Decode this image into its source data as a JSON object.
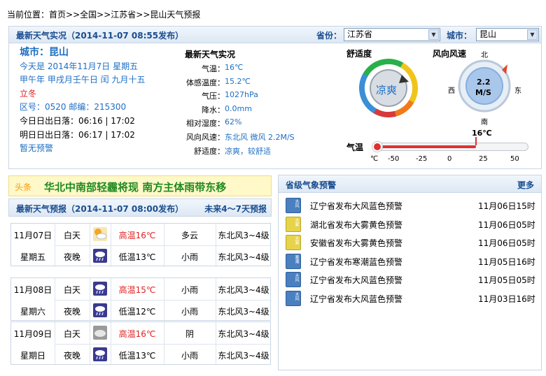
{
  "breadcrumb": {
    "label": "当前位置：",
    "home": "首页",
    "sep1": ">>",
    "country": "全国",
    "sep2": ">>",
    "province": "江苏省",
    "sep3": ">>",
    "current": "昆山天气预报"
  },
  "live": {
    "header_title": "最新天气实况（2014-11-07 08:55发布）",
    "province_label": "省份：",
    "province_value": "江苏省",
    "city_label": "城市：",
    "city_value": "昆山",
    "city_title": "城市：昆山",
    "date_line": "今天是 2014年11月7日 星期五",
    "lunar_prefix": "甲午年 甲戌月壬午日 闰",
    "lunar_month": "九月十五",
    "solar_term": "立冬",
    "postal_line": "区号：0520  邮编：215300",
    "today_sun": "今日日出日落：06:16 | 17:02",
    "tomorrow_sun": "明日日出日落：06:17 | 17:02",
    "alert_none": "暂无预警",
    "obs_title": "最新天气实况",
    "obs": [
      {
        "key": "气温：",
        "val": "16℃"
      },
      {
        "key": "体感温度：",
        "val": "15.2℃"
      },
      {
        "key": "气压：",
        "val": "1027hPa"
      },
      {
        "key": "降水：",
        "val": "0.0mm"
      },
      {
        "key": "相对湿度：",
        "val": "62%"
      },
      {
        "key": "风向风速：",
        "val": "东北风 微风 2.2M/S"
      },
      {
        "key": "舒适度：",
        "val": "凉爽，较舒适"
      }
    ],
    "comfort_title": "舒适度",
    "comfort_value": "凉爽",
    "wind_title": "风向风速",
    "wind_speed": "2.2",
    "wind_unit": "M/S",
    "compass": {
      "n": "北",
      "s": "南",
      "w": "西",
      "e": "东"
    },
    "temp_label": "气温",
    "temp_value": "16℃",
    "temp_fraction": 0.66,
    "temp_ticks": [
      "℃",
      "-50",
      "-25",
      "0",
      "25",
      "50"
    ]
  },
  "news": {
    "tag": "头条",
    "headline": "华北中南部轻霾将现 南方主体雨带东移"
  },
  "forecast": {
    "header_title": "最新天气预报（2014-11-07 08:00发布）",
    "more_link": "未来4～7天预报",
    "days": [
      {
        "date": "11月07日",
        "weekday": "星期五",
        "day": {
          "period": "白天",
          "icon": "sun-cloud",
          "temp": "高温16℃",
          "weather": "多云",
          "wind": "东北风3~4级"
        },
        "night": {
          "period": "夜晚",
          "icon": "rain-cloud",
          "temp": "低温13℃",
          "weather": "小雨",
          "wind": "东北风3~4级"
        }
      },
      {
        "date": "11月08日",
        "weekday": "星期六",
        "day": {
          "period": "白天",
          "icon": "rain-cloud",
          "temp": "高温15℃",
          "weather": "小雨",
          "wind": "东北风3~4级"
        },
        "night": {
          "period": "夜晚",
          "icon": "rain-cloud",
          "temp": "低温12℃",
          "weather": "小雨",
          "wind": "东北风3~4级"
        }
      },
      {
        "date": "11月09日",
        "weekday": "星期日",
        "day": {
          "period": "白天",
          "icon": "overcast-cloud",
          "temp": "高温16℃",
          "weather": "阴",
          "wind": "东北风3~4级"
        },
        "night": {
          "period": "夜晚",
          "icon": "rain-cloud",
          "temp": "低温13℃",
          "weather": "小雨",
          "wind": "东北风3~4级"
        }
      }
    ]
  },
  "warnings": {
    "title": "省级气象预警",
    "more": "更多",
    "items": [
      {
        "icon": "gale-blue",
        "icon_text": "大风",
        "text": "辽宁省发布大风蓝色预警",
        "time": "11月06日15时"
      },
      {
        "icon": "fog-yellow",
        "icon_text": "大雾",
        "text": "湖北省发布大雾黄色预警",
        "time": "11月06日05时"
      },
      {
        "icon": "fog-yellow",
        "icon_text": "大雾",
        "text": "安徽省发布大雾黄色预警",
        "time": "11月06日05时"
      },
      {
        "icon": "cold-blue",
        "icon_text": "寒潮",
        "text": "辽宁省发布寒潮蓝色预警",
        "time": "11月05日16时"
      },
      {
        "icon": "gale-blue",
        "icon_text": "大风",
        "text": "辽宁省发布大风蓝色预警",
        "time": "11月05日05时"
      },
      {
        "icon": "gale-blue",
        "icon_text": "大风",
        "text": "辽宁省发布大风蓝色预警",
        "time": "11月03日16时"
      }
    ]
  },
  "colors": {
    "link": "#1d6fc4",
    "alert": "#e02020",
    "news_green": "#1f8a1f",
    "blue_warn": "#4a7fc0",
    "yellow_warn": "#e6d34a"
  }
}
